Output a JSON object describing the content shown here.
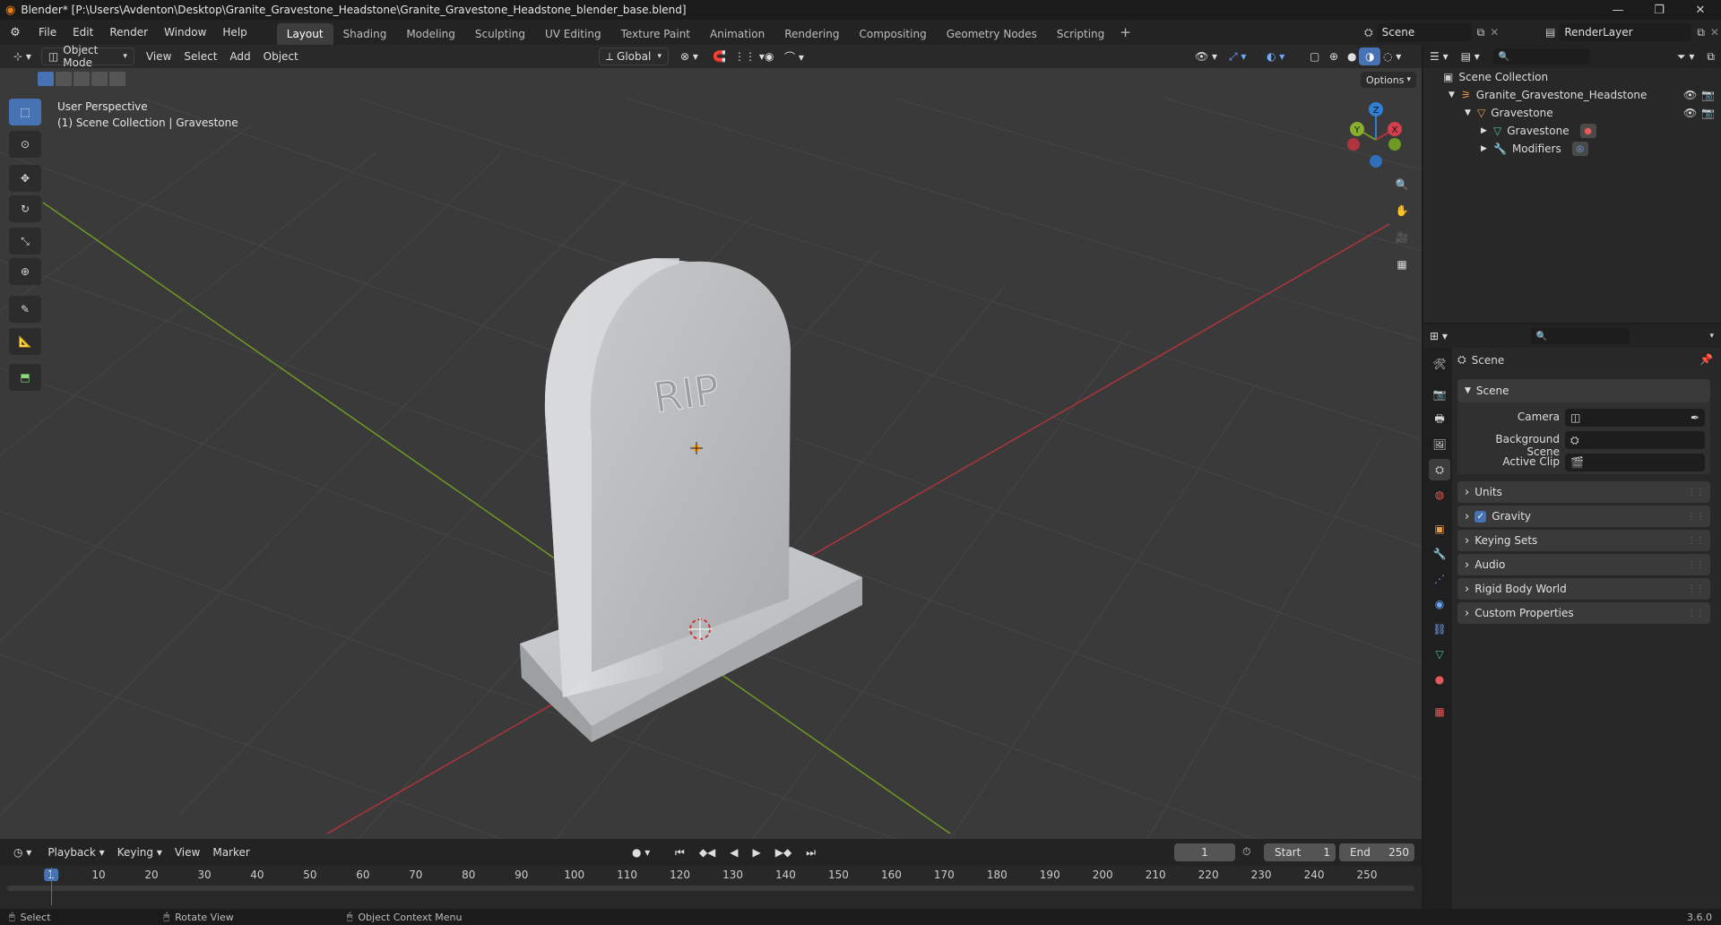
{
  "window": {
    "title": "Blender* [P:\\Users\\Avdenton\\Desktop\\Granite_Gravestone_Headstone\\Granite_Gravestone_Headstone_blender_base.blend]"
  },
  "menus": [
    "File",
    "Edit",
    "Render",
    "Window",
    "Help"
  ],
  "workspaces": {
    "tabs": [
      "Layout",
      "Shading",
      "Modeling",
      "Sculpting",
      "UV Editing",
      "Texture Paint",
      "Animation",
      "Rendering",
      "Compositing",
      "Geometry Nodes",
      "Scripting"
    ],
    "active": "Layout",
    "add_symbol": "+"
  },
  "scene_selector": {
    "scene": "Scene",
    "view_layer": "RenderLayer"
  },
  "viewport": {
    "mode": "Object Mode",
    "menus": [
      "View",
      "Select",
      "Add",
      "Object"
    ],
    "transform_orientation": "Global",
    "options_label": "Options",
    "overlay_line1": "User Perspective",
    "overlay_line2": "(1) Scene Collection | Gravestone",
    "engraving": "RIP",
    "gizmo_axes": {
      "x": "X",
      "y": "Y",
      "z": "Z"
    }
  },
  "outliner": {
    "root": "Scene Collection",
    "items": [
      {
        "label": "Granite_Gravestone_Headstone",
        "kind": "collection"
      },
      {
        "label": "Gravestone",
        "kind": "object"
      },
      {
        "label": "Gravestone",
        "kind": "mesh"
      },
      {
        "label": "Modifiers",
        "kind": "modifiers"
      }
    ]
  },
  "properties": {
    "context": "Scene",
    "panel_open": "Scene",
    "fields": [
      {
        "label": "Camera",
        "value": ""
      },
      {
        "label": "Background Scene",
        "value": ""
      },
      {
        "label": "Active Clip",
        "value": ""
      }
    ],
    "panels": [
      {
        "label": "Units",
        "checkbox": false
      },
      {
        "label": "Gravity",
        "checkbox": true
      },
      {
        "label": "Keying Sets",
        "checkbox": false
      },
      {
        "label": "Audio",
        "checkbox": false
      },
      {
        "label": "Rigid Body World",
        "checkbox": false
      },
      {
        "label": "Custom Properties",
        "checkbox": false
      }
    ]
  },
  "timeline": {
    "menus": [
      "Playback",
      "Keying",
      "View",
      "Marker"
    ],
    "current_frame": "1",
    "start_label": "Start",
    "start": "1",
    "end_label": "End",
    "end": "250",
    "ticks": [
      "1",
      "10",
      "20",
      "30",
      "40",
      "50",
      "60",
      "70",
      "80",
      "90",
      "100",
      "110",
      "120",
      "130",
      "140",
      "150",
      "160",
      "170",
      "180",
      "190",
      "200",
      "210",
      "220",
      "230",
      "240",
      "250"
    ]
  },
  "status_bar": {
    "select": "Select",
    "rotate": "Rotate View",
    "context_menu": "Object Context Menu",
    "version": "3.6.0"
  },
  "colors": {
    "accent": "#4772b3",
    "x_axis": "#b0343e",
    "y_axis": "#6e9a23",
    "z_axis": "#2f7fd6",
    "viewport_bg": "#3c3c3c"
  }
}
